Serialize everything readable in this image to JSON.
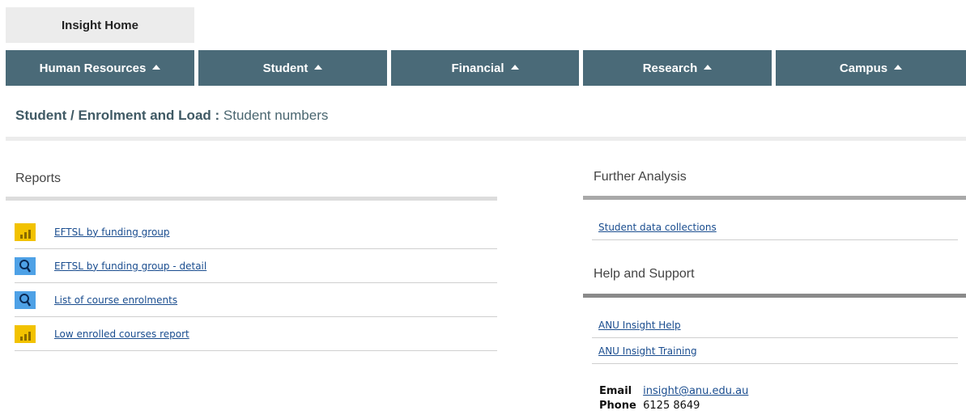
{
  "home": {
    "label": "Insight Home"
  },
  "nav": [
    {
      "label": "Human Resources"
    },
    {
      "label": "Student"
    },
    {
      "label": "Financial"
    },
    {
      "label": "Research"
    },
    {
      "label": "Campus"
    }
  ],
  "breadcrumb": {
    "path": "Student / Enrolment and Load :",
    "page": "Student numbers"
  },
  "reports": {
    "title": "Reports",
    "items": [
      {
        "label": "EFTSL by funding group",
        "icon": "bar-chart-icon"
      },
      {
        "label": "EFTSL by funding group - detail",
        "icon": "search-icon"
      },
      {
        "label": "List of course enrolments",
        "icon": "search-icon"
      },
      {
        "label": "Low enrolled courses report",
        "icon": "bar-chart-icon"
      }
    ]
  },
  "further_analysis": {
    "title": "Further Analysis",
    "items": [
      {
        "label": "Student data collections"
      }
    ]
  },
  "help": {
    "title": "Help and Support",
    "items": [
      {
        "label": "ANU Insight Help"
      },
      {
        "label": "ANU Insight Training"
      }
    ],
    "email_label": "Email",
    "email": "insight@anu.edu.au",
    "phone_label": "Phone",
    "phone": "6125 8649"
  },
  "colors": {
    "nav_bg": "#4a6a78",
    "link": "#1a4d8f",
    "bar_icon": "#f2c200",
    "search_icon": "#4ea1e6"
  }
}
